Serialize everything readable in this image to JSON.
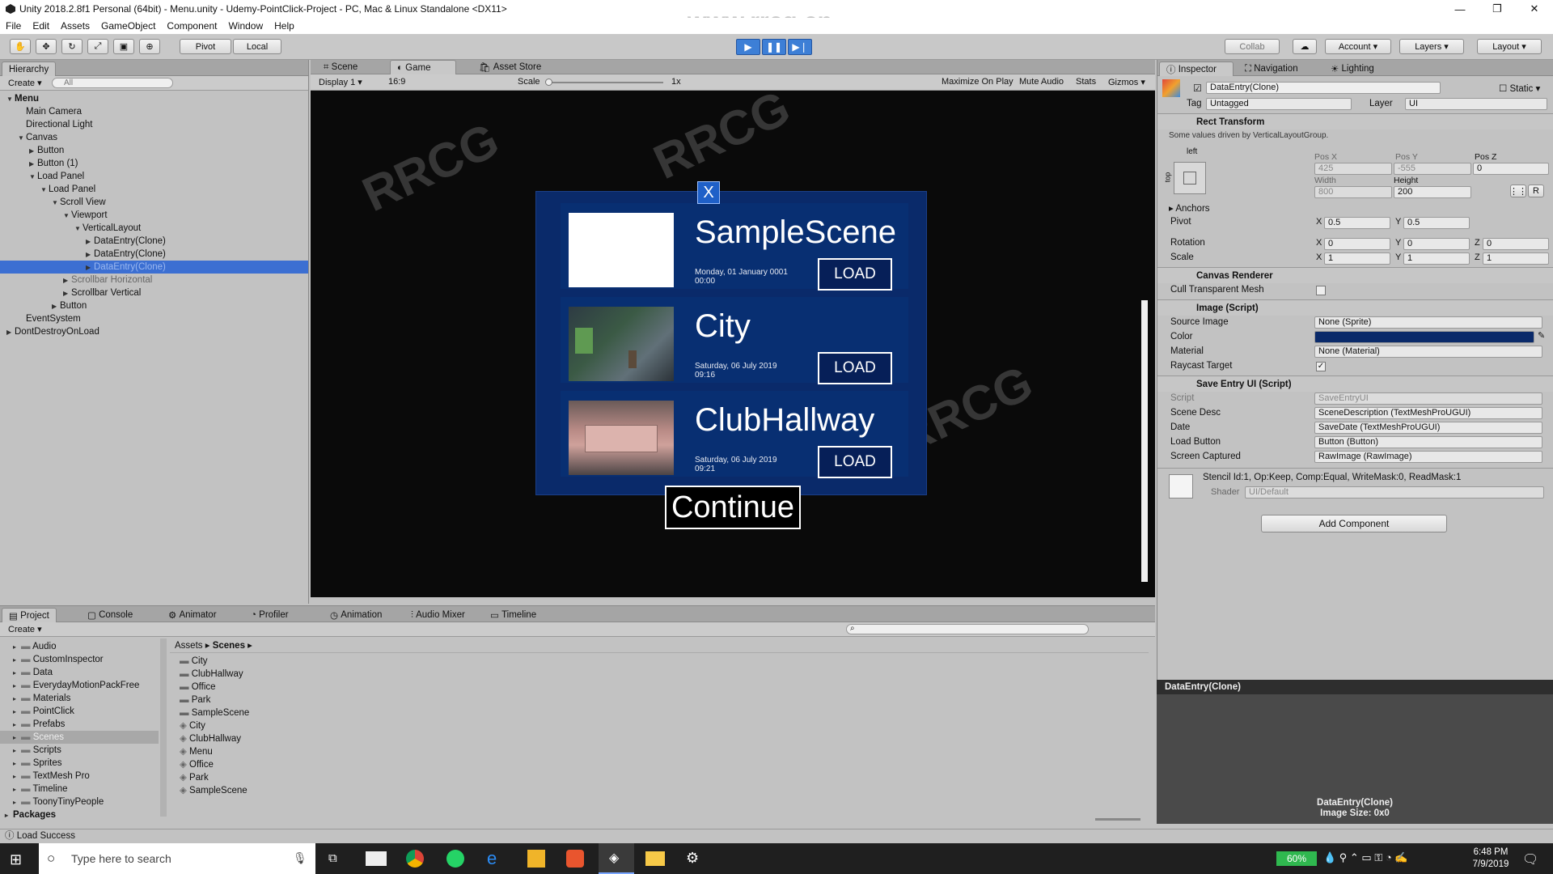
{
  "window": {
    "title": "Unity 2018.2.8f1 Personal (64bit) - Menu.unity - Udemy-PointClick-Project - PC, Mac & Linux Standalone <DX11>"
  },
  "watermark": "www.rrcg.cn",
  "menu": [
    "File",
    "Edit",
    "Assets",
    "GameObject",
    "Component",
    "Window",
    "Help"
  ],
  "toolbar": {
    "pivot": "Pivot",
    "local": "Local",
    "collab": "Collab",
    "account": "Account",
    "layers": "Layers",
    "layout": "Layout"
  },
  "hierarchy": {
    "tab": "Hierarchy",
    "create": "Create",
    "search": "All",
    "items": [
      {
        "label": "Menu",
        "depth": 0,
        "arrow": "▼",
        "bold": true
      },
      {
        "label": "Main Camera",
        "depth": 1,
        "arrow": ""
      },
      {
        "label": "Directional Light",
        "depth": 1,
        "arrow": ""
      },
      {
        "label": "Canvas",
        "depth": 1,
        "arrow": "▼"
      },
      {
        "label": "Button",
        "depth": 2,
        "arrow": "▶"
      },
      {
        "label": "Button (1)",
        "depth": 2,
        "arrow": "▶"
      },
      {
        "label": "Load Panel",
        "depth": 2,
        "arrow": "▼"
      },
      {
        "label": "Load Panel",
        "depth": 3,
        "arrow": "▼"
      },
      {
        "label": "Scroll View",
        "depth": 4,
        "arrow": "▼"
      },
      {
        "label": "Viewport",
        "depth": 5,
        "arrow": "▼"
      },
      {
        "label": "VerticalLayout",
        "depth": 6,
        "arrow": "▼"
      },
      {
        "label": "DataEntry(Clone)",
        "depth": 7,
        "arrow": "▶"
      },
      {
        "label": "DataEntry(Clone)",
        "depth": 7,
        "arrow": "▶"
      },
      {
        "label": "DataEntry(Clone)",
        "depth": 7,
        "arrow": "▶",
        "selected": true
      },
      {
        "label": "Scrollbar Horizontal",
        "depth": 5,
        "arrow": "▶",
        "dim": true
      },
      {
        "label": "Scrollbar Vertical",
        "depth": 5,
        "arrow": "▶"
      },
      {
        "label": "Button",
        "depth": 4,
        "arrow": "▶"
      },
      {
        "label": "EventSystem",
        "depth": 1,
        "arrow": ""
      },
      {
        "label": "DontDestroyOnLoad",
        "depth": 0,
        "arrow": "▶"
      }
    ]
  },
  "scene_tabs": {
    "scene": "Scene",
    "game": "Game",
    "asset_store": "Asset Store"
  },
  "game_bar": {
    "display": "Display 1",
    "aspect": "16:9",
    "scale_label": "Scale",
    "scale_value": "1x",
    "maximize": "Maximize On Play",
    "mute": "Mute Audio",
    "stats": "Stats",
    "gizmos": "Gizmos"
  },
  "game": {
    "entries": [
      {
        "title": "SampleScene",
        "date": "Monday, 01 January 0001",
        "time": "00:00",
        "load": "LOAD"
      },
      {
        "title": "City",
        "date": "Saturday, 06 July 2019",
        "time": "09:16",
        "load": "LOAD"
      },
      {
        "title": "ClubHallway",
        "date": "Saturday, 06 July 2019",
        "time": "09:21",
        "load": "LOAD"
      }
    ],
    "close": "X",
    "continue": "Continue"
  },
  "inspector": {
    "tabs": {
      "inspector": "Inspector",
      "navigation": "Navigation",
      "lighting": "Lighting"
    },
    "object_name": "DataEntry(Clone)",
    "static": "Static",
    "tag_label": "Tag",
    "tag": "Untagged",
    "layer_label": "Layer",
    "layer": "UI",
    "rect": {
      "title": "Rect Transform",
      "note": "Some values driven by VerticalLayoutGroup.",
      "anchor": "left",
      "side": "top",
      "posx_label": "Pos X",
      "posy_label": "Pos Y",
      "posz_label": "Pos Z",
      "posx": "425",
      "posy": "-555",
      "posz": "0",
      "width_label": "Width",
      "height_label": "Height",
      "width": "800",
      "height": "200",
      "anchors": "Anchors",
      "pivot": "Pivot",
      "pivot_x": "0.5",
      "pivot_y": "0.5",
      "rotation": "Rotation",
      "rot_x": "0",
      "rot_y": "0",
      "rot_z": "0",
      "scale": "Scale",
      "sc_x": "1",
      "sc_y": "1",
      "sc_z": "1",
      "x": "X",
      "y": "Y",
      "z": "Z"
    },
    "canvas_renderer": {
      "title": "Canvas Renderer",
      "cull": "Cull Transparent Mesh"
    },
    "image": {
      "title": "Image (Script)",
      "source_label": "Source Image",
      "source": "None (Sprite)",
      "color_label": "Color",
      "color": "#0a2a6a",
      "material_label": "Material",
      "material": "None (Material)",
      "raycast_label": "Raycast Target"
    },
    "save_entry": {
      "title": "Save Entry UI (Script)",
      "script_label": "Script",
      "script": "SaveEntryUI",
      "scene_desc_label": "Scene Desc",
      "scene_desc": "SceneDescription (TextMeshProUGUI)",
      "date_label": "Date",
      "date": "SaveDate (TextMeshProUGUI)",
      "load_label": "Load Button",
      "load": "Button (Button)",
      "screen_label": "Screen Captured",
      "screen": "RawImage (RawImage)"
    },
    "material": {
      "name": "Stencil Id:1, Op:Keep, Comp:Equal, WriteMask:0, ReadMask:1",
      "shader_label": "Shader",
      "shader": "UI/Default"
    },
    "add_component": "Add Component",
    "preview_title": "DataEntry(Clone)",
    "preview_line1": "DataEntry(Clone)",
    "preview_line2": "Image Size: 0x0"
  },
  "bottom_tabs": {
    "project": "Project",
    "console": "Console",
    "animator": "Animator",
    "profiler": "Profiler",
    "animation": "Animation",
    "audio_mixer": "Audio Mixer",
    "timeline": "Timeline"
  },
  "project": {
    "create": "Create",
    "folders": [
      "Audio",
      "CustomInspector",
      "Data",
      "EverydayMotionPackFree",
      "Materials",
      "PointClick",
      "Prefabs",
      "Scenes",
      "Scripts",
      "Sprites",
      "TextMesh Pro",
      "Timeline",
      "ToonyTinyPeople"
    ],
    "packages": "Packages",
    "breadcrumb_root": "Assets",
    "breadcrumb_leaf": "Scenes",
    "assets": [
      {
        "name": "City",
        "kind": "folder"
      },
      {
        "name": "ClubHallway",
        "kind": "folder"
      },
      {
        "name": "Office",
        "kind": "folder"
      },
      {
        "name": "Park",
        "kind": "folder"
      },
      {
        "name": "SampleScene",
        "kind": "folder"
      },
      {
        "name": "City",
        "kind": "scene"
      },
      {
        "name": "ClubHallway",
        "kind": "scene"
      },
      {
        "name": "Menu",
        "kind": "scene"
      },
      {
        "name": "Office",
        "kind": "scene"
      },
      {
        "name": "Park",
        "kind": "scene"
      },
      {
        "name": "SampleScene",
        "kind": "scene"
      }
    ]
  },
  "status": "Load Success",
  "taskbar": {
    "search": "Type here to search",
    "battery": "60%",
    "time": "6:48 PM",
    "date": "7/9/2019"
  }
}
